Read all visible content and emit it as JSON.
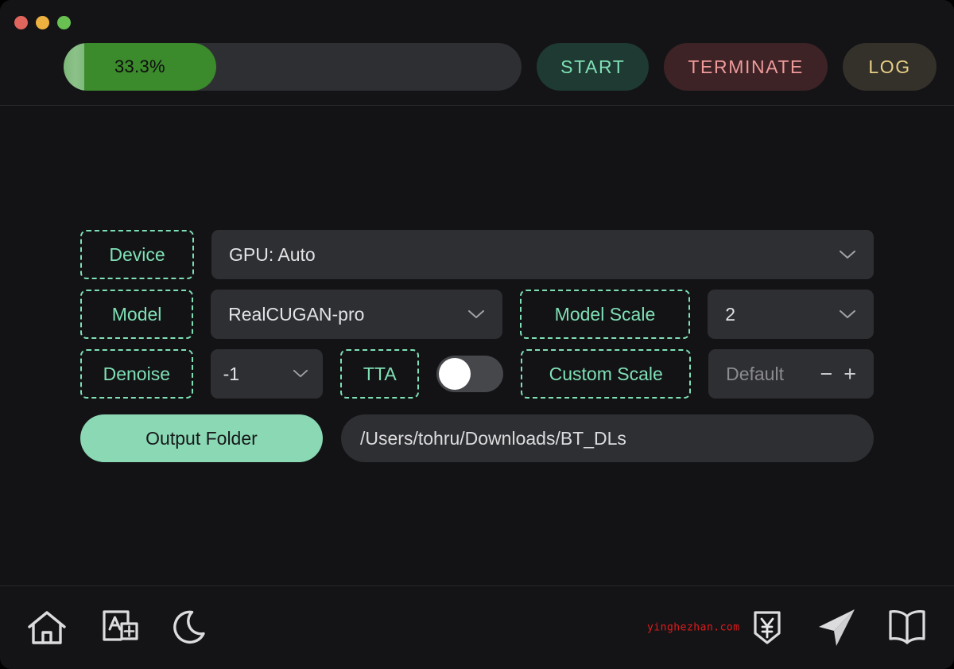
{
  "window": {
    "traffic_lights": [
      {
        "name": "close",
        "color": "#e0655c"
      },
      {
        "name": "minimize",
        "color": "#edb140"
      },
      {
        "name": "zoom",
        "color": "#69c152"
      }
    ]
  },
  "toolbar": {
    "progress": {
      "percent": 33.3,
      "label": "33.3%",
      "fill_color": "#3b8a2c",
      "track_color": "#2e2f32"
    },
    "start_label": "START",
    "terminate_label": "TERMINATE",
    "log_label": "LOG",
    "start_color": "#7fe0b5",
    "terminate_color": "#ef9a9a",
    "log_color": "#e8cf86"
  },
  "form": {
    "accent_color": "#7fe0b5",
    "device": {
      "label": "Device",
      "value": "GPU: Auto"
    },
    "model": {
      "label": "Model",
      "value": "RealCUGAN-pro"
    },
    "model_scale": {
      "label": "Model Scale",
      "value": "2"
    },
    "denoise": {
      "label": "Denoise",
      "value": "-1"
    },
    "tta": {
      "label": "TTA",
      "enabled": false
    },
    "custom_scale": {
      "label": "Custom Scale",
      "value": "Default",
      "minus": "−",
      "plus": "+"
    },
    "output_folder": {
      "label": "Output Folder",
      "path": "/Users/tohru/Downloads/BT_DLs",
      "button_color": "#8ad9b4"
    }
  },
  "bottombar": {
    "left_icons": [
      {
        "name": "home-icon",
        "title": "Home"
      },
      {
        "name": "translate-icon",
        "title": "Language"
      },
      {
        "name": "moon-icon",
        "title": "Dark mode"
      }
    ],
    "right_icons": [
      {
        "name": "donate-yen-icon",
        "title": "Donate"
      },
      {
        "name": "send-icon",
        "title": "Telegram"
      },
      {
        "name": "book-icon",
        "title": "Docs"
      }
    ],
    "watermark": "yinghezhan.com",
    "watermark_color": "#e01b1b"
  }
}
